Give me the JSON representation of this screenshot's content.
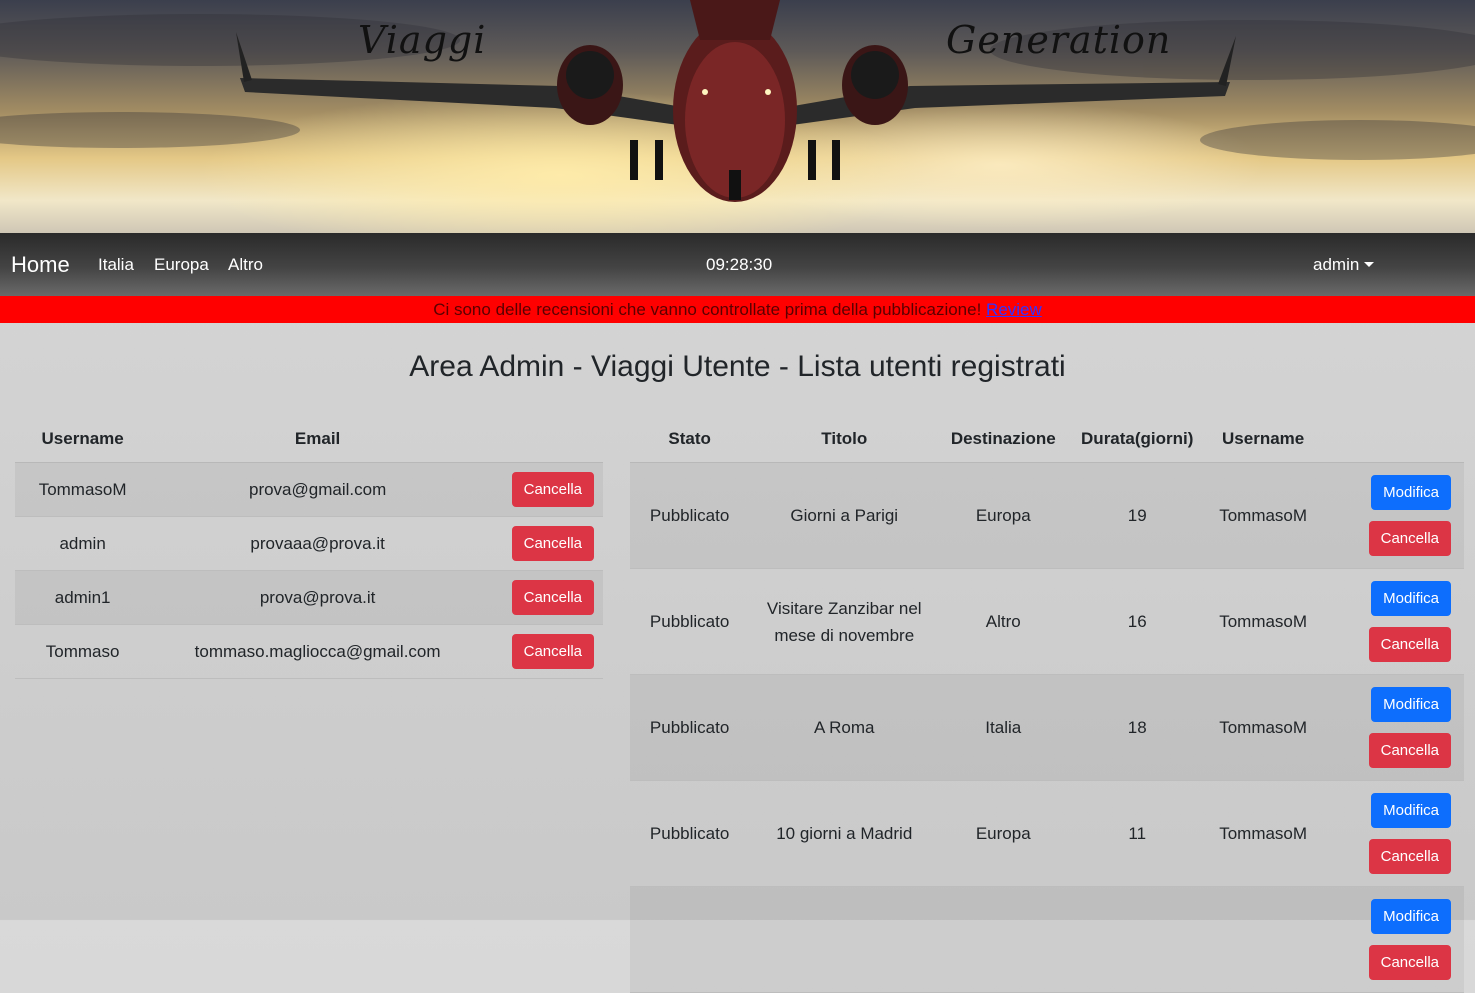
{
  "banner": {
    "title_left": "Viaggi",
    "title_right": "Generation"
  },
  "navbar": {
    "brand": "Home",
    "links": [
      "Italia",
      "Europa",
      "Altro"
    ],
    "clock": "09:28:30",
    "user": "admin"
  },
  "alert": {
    "text": "Ci sono delle recensioni che vanno controllate prima della pubblicazione! ",
    "link": "Review"
  },
  "page_title": "Area Admin - Viaggi Utente - Lista utenti registrati",
  "users_table": {
    "headers": [
      "Username",
      "Email"
    ],
    "delete_label": "Cancella",
    "rows": [
      {
        "username": "TommasoM",
        "email": "prova@gmail.com"
      },
      {
        "username": "admin",
        "email": "provaaa@prova.it"
      },
      {
        "username": "admin1",
        "email": "prova@prova.it"
      },
      {
        "username": "Tommaso",
        "email": "tommaso.magliocca@gmail.com"
      }
    ]
  },
  "trips_table": {
    "headers": [
      "Stato",
      "Titolo",
      "Destinazione",
      "Durata(giorni)",
      "Username"
    ],
    "edit_label": "Modifica",
    "delete_label": "Cancella",
    "rows": [
      {
        "stato": "Pubblicato",
        "titolo": "Giorni a Parigi",
        "destinazione": "Europa",
        "durata": "19",
        "username": "TommasoM"
      },
      {
        "stato": "Pubblicato",
        "titolo": "Visitare Zanzibar nel mese di novembre",
        "destinazione": "Altro",
        "durata": "16",
        "username": "TommasoM"
      },
      {
        "stato": "Pubblicato",
        "titolo": "A Roma",
        "destinazione": "Italia",
        "durata": "18",
        "username": "TommasoM"
      },
      {
        "stato": "Pubblicato",
        "titolo": "10 giorni a Madrid",
        "destinazione": "Europa",
        "durata": "11",
        "username": "TommasoM"
      },
      {
        "stato": "",
        "titolo": "",
        "destinazione": "",
        "durata": "",
        "username": ""
      }
    ]
  },
  "colors": {
    "alert_bg": "#ff0000",
    "danger": "#dc3545",
    "primary": "#0d6efd"
  },
  "icons": [
    "caret-down-icon",
    "airplane-banner-image"
  ]
}
